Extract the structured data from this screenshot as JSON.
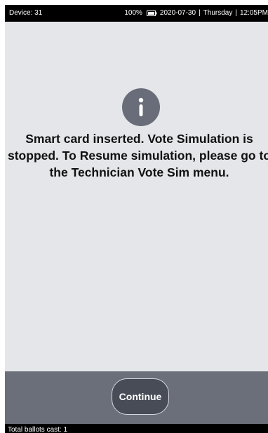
{
  "status_bar": {
    "device": "Device: 31",
    "battery_percent": "100%",
    "date": "2020-07-30",
    "separator1": "|",
    "day": "Thursday",
    "separator2": "|",
    "time": "12:05PM",
    "battery_icon": "battery-icon"
  },
  "content": {
    "icon": "info-icon",
    "message": "Smart card inserted. Vote Simulation is stopped. To Resume simulation, please go to the Technician Vote Sim menu."
  },
  "footer": {
    "continue_label": "Continue"
  },
  "bottom_bar": {
    "ballots_text": "Total ballots cast: 1"
  },
  "colors": {
    "screen_background": "#e5e6ea",
    "status_bar": "#000000",
    "icon_background": "#686d79",
    "footer": "#6a6f7a",
    "button": "#474c56"
  }
}
